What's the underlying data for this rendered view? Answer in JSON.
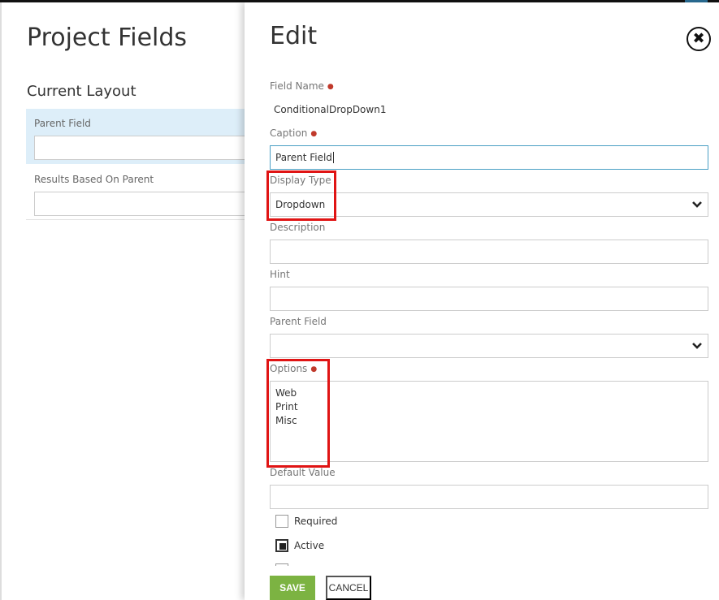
{
  "background": {
    "title": "Project Fields",
    "subtitle": "Current Layout",
    "rows": [
      {
        "label": "Parent Field"
      },
      {
        "label": "Results Based On Parent"
      }
    ]
  },
  "panel": {
    "title": "Edit",
    "fields": {
      "field_name": {
        "label": "Field Name",
        "value": "ConditionalDropDown1"
      },
      "caption": {
        "label": "Caption",
        "value": "Parent Field"
      },
      "display_type": {
        "label": "Display Type",
        "value": "Dropdown"
      },
      "description": {
        "label": "Description",
        "value": ""
      },
      "hint": {
        "label": "Hint",
        "value": ""
      },
      "parent_field": {
        "label": "Parent Field",
        "value": ""
      },
      "options": {
        "label": "Options",
        "lines": [
          "Web",
          "Print",
          "Misc"
        ]
      },
      "default_value": {
        "label": "Default Value",
        "value": ""
      }
    },
    "checkboxes": [
      {
        "label": "Required",
        "checked": false
      },
      {
        "label": "Active",
        "checked": true
      }
    ],
    "save_label": "SAVE",
    "cancel_label": "CANCEL"
  },
  "colors": {
    "accent_green": "#7cb342",
    "highlight_red": "#e01414",
    "required_dot": "#c0392b",
    "selected_row": "#ddeef9"
  },
  "icons": {
    "close": "close-circle-icon",
    "dropdown": "chevron-down-icon",
    "required": "required-dot-icon"
  }
}
